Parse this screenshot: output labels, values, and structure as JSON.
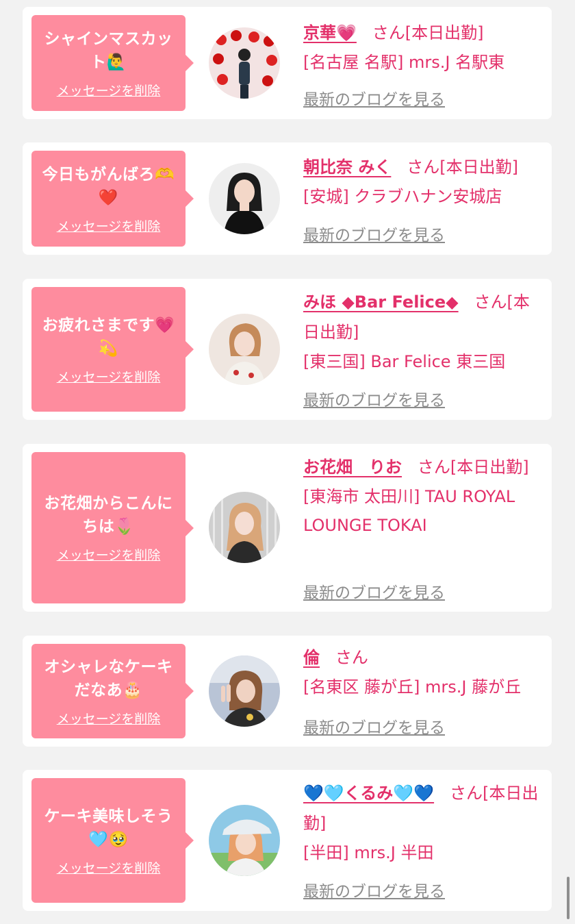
{
  "colors": {
    "bubble": "#fe8c9e",
    "accent": "#e3306a",
    "blog_link": "#8c8c8c",
    "background": "#f2f2f2"
  },
  "delete_label": "メッセージを削除",
  "blog_label": "最新のブログを見る",
  "honorific": "さん",
  "cards": [
    {
      "message": "シャインマスカット🙋‍♂️",
      "name": "京華💗",
      "status": "[本日出勤]",
      "shop": "[名古屋 名駅] mrs.J 名駅東",
      "avatar_icon": "cherry-wall-photo"
    },
    {
      "message": "今日もがんばろ🫶❤️",
      "name": "朝比奈 みく",
      "status": "[本日出勤]",
      "shop": "[安城] クラブハナン安城店",
      "avatar_icon": "portrait-photo"
    },
    {
      "message": "お疲れさまです💗💫",
      "name": "みほ ◆Bar Felice◆",
      "status": "[本日出勤]",
      "shop": "[東三国] Bar Felice 東三国",
      "avatar_icon": "portrait-photo"
    },
    {
      "message": "お花畑からこんにちは🌷",
      "name": "お花畑　りお",
      "status": "[本日出勤]",
      "shop": "[東海市 太田川] TAU ROYAL LOUNGE TOKAI",
      "avatar_icon": "portrait-photo"
    },
    {
      "message": "オシャレなケーキだなあ🎂",
      "name": "倫",
      "status": "",
      "shop": "[名東区 藤が丘] mrs.J 藤が丘",
      "avatar_icon": "peace-sign-photo"
    },
    {
      "message": "ケーキ美味しそう🩵🥹",
      "name": "💙🩵くるみ🩵💙",
      "status": "[本日出勤]",
      "shop": "[半田] mrs.J 半田",
      "avatar_icon": "cap-portrait-photo"
    }
  ]
}
